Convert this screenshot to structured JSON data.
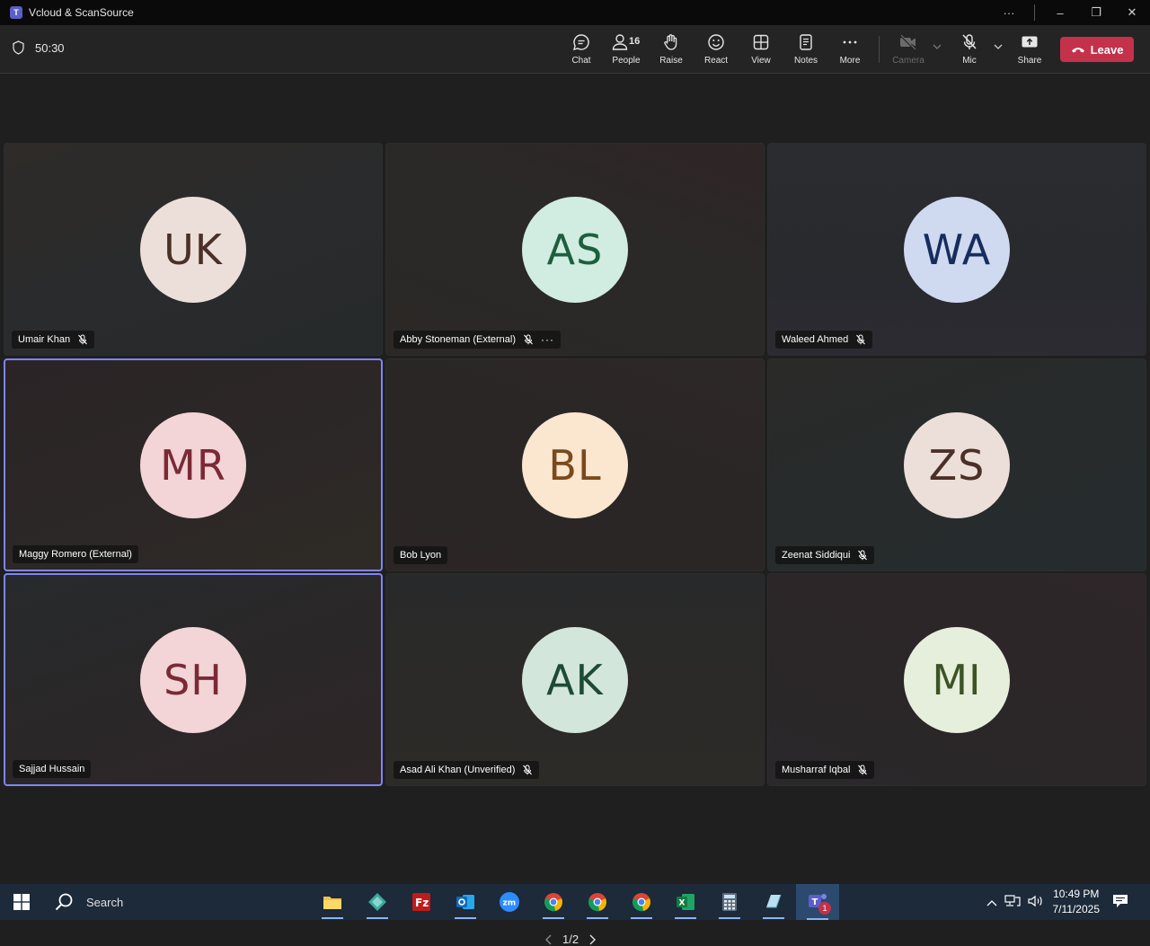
{
  "window": {
    "title": "Vcloud & ScanSource",
    "controls": {
      "more": "···",
      "minimize": "–",
      "restore": "❐",
      "close": "✕"
    }
  },
  "toolbar": {
    "timer": "50:30",
    "chat": "Chat",
    "people": "People",
    "people_count": "16",
    "raise": "Raise",
    "react": "React",
    "view": "View",
    "notes": "Notes",
    "more": "More",
    "camera": "Camera",
    "mic": "Mic",
    "share": "Share",
    "leave": "Leave"
  },
  "participants": [
    {
      "initials": "UK",
      "name": "Umair Khan",
      "muted": true,
      "bg": "#ecdfd9",
      "fg": "#4a3027"
    },
    {
      "initials": "AS",
      "name": "Abby Stoneman (External)",
      "muted": true,
      "bg": "#d1ece0",
      "fg": "#1e5e3e"
    },
    {
      "initials": "WA",
      "name": "Waleed Ahmed",
      "muted": true,
      "bg": "#cfd9ef",
      "fg": "#172c5e"
    },
    {
      "initials": "MR",
      "name": "Maggy Romero (External)",
      "muted": false,
      "bg": "#f3d4d7",
      "fg": "#7a2a35"
    },
    {
      "initials": "BL",
      "name": "Bob Lyon",
      "muted": false,
      "bg": "#fbe6d0",
      "fg": "#7a4a1c"
    },
    {
      "initials": "ZS",
      "name": "Zeenat Siddiqui",
      "muted": true,
      "bg": "#ecdfd9",
      "fg": "#4a3027"
    },
    {
      "initials": "SH",
      "name": "Sajjad Hussain",
      "muted": false,
      "bg": "#f3d4d7",
      "fg": "#7a2a35"
    },
    {
      "initials": "AK",
      "name": "Asad Ali Khan (Unverified)",
      "muted": true,
      "bg": "#d3e6dc",
      "fg": "#1e4a34"
    },
    {
      "initials": "MI",
      "name": "Musharraf Iqbal",
      "muted": true,
      "bg": "#e6eedc",
      "fg": "#3c5424"
    }
  ],
  "pager": {
    "label": "1/2"
  },
  "taskbar": {
    "search": "Search",
    "time": "10:49 PM",
    "date": "7/11/2025",
    "teams_badge": "1"
  }
}
